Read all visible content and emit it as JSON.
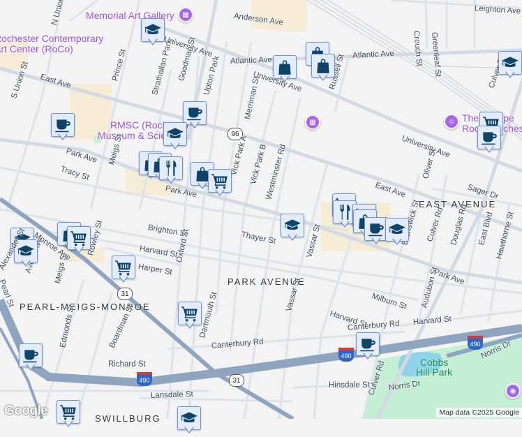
{
  "map": {
    "attribution": "Map data ©2025 Google",
    "logo": "Google",
    "colors": {
      "background": "#f4f3f4",
      "road": "#d5dce6",
      "highway": "#8ea4bf",
      "park": "#c4efd5",
      "water": "#8fd3ea",
      "poi": "#9a4fe0",
      "marker_fill": "#e4ecfa",
      "marker_icon": "#0e4468"
    }
  },
  "pois": {
    "memorial_art_gallery": "Memorial Art Gallery",
    "roco_1": "Rochester Contemporary",
    "roco_2": "Art Center (RoCo)",
    "rmsc_1": "RMSC (Rochester",
    "rmsc_2": "Museum & Science",
    "escape_1": "The Escape",
    "escape_2": "Room Rochester",
    "cobbs_1": "Cobbs",
    "cobbs_2": "Hill Park"
  },
  "neighborhoods": {
    "east_avenue": "EAST AVENUE",
    "park_avenue": "PARK AVENUE",
    "pearl_meigs_monroe": "PEARL-MEIGS-MONROE",
    "swillburg": "SWILLBURG"
  },
  "shields": {
    "route_96": "96",
    "route_31": "31",
    "i490": "490"
  },
  "streets": {
    "anderson_ave": "Anderson Ave",
    "leighton_ave": "Leighton Ave",
    "atlantic_ave": "Atlantic Ave",
    "university_ave": "University Ave",
    "east_ave": "East Ave",
    "park_ave": "Park Ave",
    "tracy_st": "Tracy St",
    "brighton_st": "Brighton St",
    "thayer_st": "Thayer St",
    "harvard_st": "Harvard St",
    "harper_st": "Harper St",
    "milburn_st": "Milburn St",
    "canterbury_rd": "Canterbury Rd",
    "richard_st": "Richard St",
    "lansdale_st": "Lansdale St",
    "hinsdale_st": "Hinsdale St",
    "norris_dr": "Norris Dr",
    "s_union_st": "S Union St",
    "n_union_st": "N Union St",
    "prince_st": "Prince St",
    "strathallan_park": "Strathallan Park",
    "goodman_st": "Goodman St",
    "upton_park": "Upton Park",
    "merriman_st": "Merriman St",
    "russell_st": "Russell St",
    "crouch_st": "Crouch St",
    "greenleaf_st": "Greenleaf St",
    "meigs_st": "Meigs St",
    "vick_park_a": "Vick Park A",
    "vick_park_b": "Vick Park B",
    "westminster_rd": "Westminster Rd",
    "vassar_st": "Vassar St",
    "oliver_st": "Oliver St",
    "sager_dr": "Sager Dr",
    "culver_rd": "Culver Rd",
    "brunswick_st": "Brunswick St",
    "douglas_rd": "Douglas Rd",
    "east_blvd": "East Blvd",
    "hawthorne_st": "Hawthorne St",
    "audubon_st": "Audubon St",
    "oxford_st": "Oxford St",
    "dartmouth_st": "Dartmouth St",
    "rowley_st": "Rowley St",
    "averill_ave": "Averill Ave",
    "pearl_st": "Pearl St",
    "edmonds_st": "Edmonds St",
    "boardman_st": "Boardman St",
    "alexander_st": "Alexander St",
    "monroe_ave": "Monroe Ave"
  }
}
